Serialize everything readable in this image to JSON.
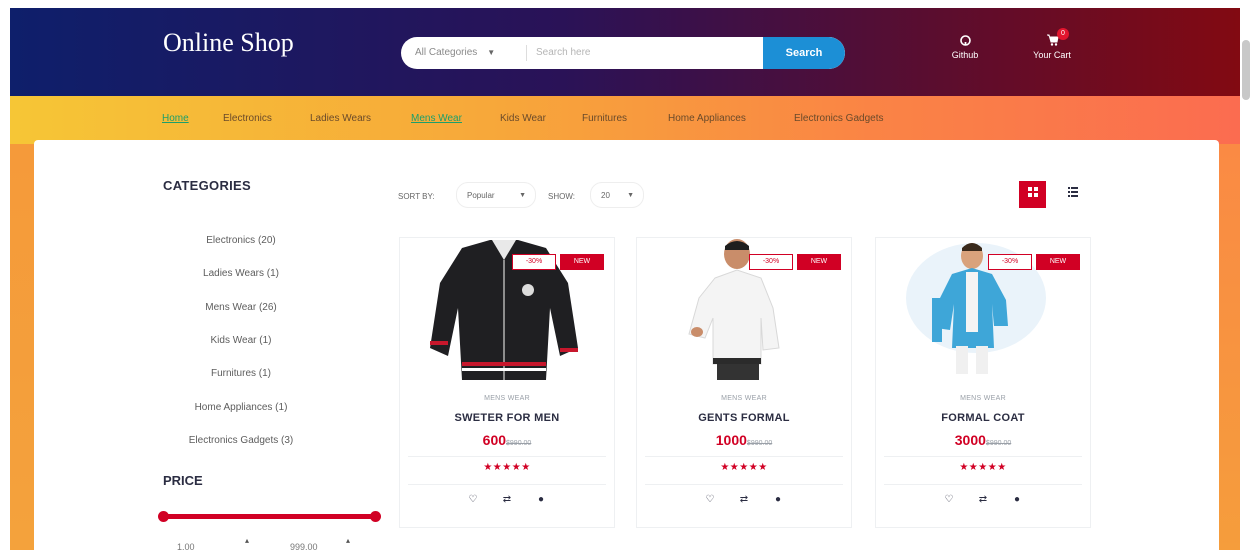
{
  "header": {
    "logo": "Online Shop",
    "search": {
      "category_value": "All Categories",
      "placeholder": "Search here",
      "button_label": "Search"
    },
    "github_label": "Github",
    "cart_label": "Your Cart",
    "cart_count": "0"
  },
  "nav": {
    "items": [
      "Home",
      "Electronics",
      "Ladies Wears",
      "Mens Wear",
      "Kids Wear",
      "Furnitures",
      "Home Appliances",
      "Electronics Gadgets"
    ],
    "active_items": [
      "Home",
      "Mens Wear"
    ]
  },
  "sidebar": {
    "categories_title": "CATEGORIES",
    "categories": [
      "Electronics (20)",
      "Ladies Wears (1)",
      "Mens Wear (26)",
      "Kids Wear (1)",
      "Furnitures (1)",
      "Home Appliances (1)",
      "Electronics Gadgets (3)"
    ],
    "price_title": "PRICE",
    "price_min": "1.00",
    "price_max": "999.00"
  },
  "toolbar": {
    "sort_label": "SORT BY:",
    "sort_value": "Popular",
    "show_label": "SHOW:",
    "show_value": "20"
  },
  "products": [
    {
      "category": "MENS WEAR",
      "name": "SWETER FOR MEN",
      "price": "600",
      "old_price": "$990.00",
      "sale": "-30%",
      "new": "NEW",
      "stars": "★★★★★"
    },
    {
      "category": "MENS WEAR",
      "name": "GENTS FORMAL",
      "price": "1000",
      "old_price": "$990.00",
      "sale": "-30%",
      "new": "NEW",
      "stars": "★★★★★"
    },
    {
      "category": "MENS WEAR",
      "name": "FORMAL COAT",
      "price": "3000",
      "old_price": "$990.00",
      "sale": "-30%",
      "new": "NEW",
      "stars": "★★★★★"
    }
  ],
  "colors": {
    "accent": "#d10024",
    "search_button": "#1c8fd6",
    "header_start": "#0e1f6b",
    "header_end": "#820a12",
    "nav_start": "#f6c636",
    "nav_end": "#fb6c50",
    "active_link": "#1c9f6b"
  },
  "icons": [
    "github-icon",
    "cart-icon",
    "grid-view-icon",
    "list-view-icon",
    "heart-icon",
    "compare-icon",
    "eye-icon"
  ]
}
